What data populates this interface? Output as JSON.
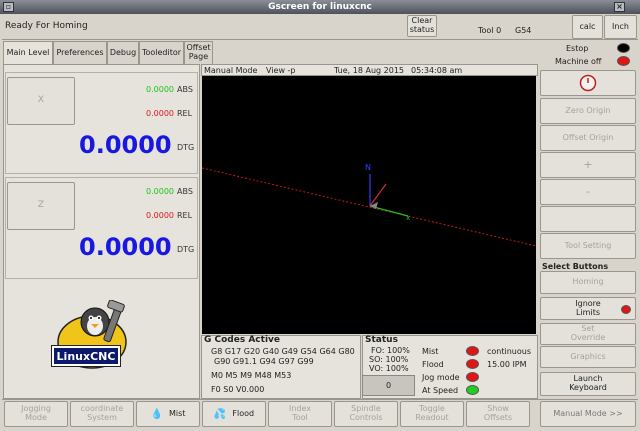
{
  "window": {
    "title": "Gscreen for linuxcnc"
  },
  "status_bar": {
    "message": "Ready For Homing",
    "clear_status": "Clear\nstatus",
    "tool": "Tool 0",
    "offset": "G54",
    "calc": "calc",
    "units": "Inch"
  },
  "tabs": [
    "Main Level",
    "Preferences",
    "Debug",
    "Tooleditor",
    "Offset\nPage"
  ],
  "axes": [
    {
      "button": "X",
      "abs": "0.0000",
      "abs_label": "ABS",
      "rel": "0.0000",
      "rel_label": "REL",
      "dtg": "0.0000",
      "dtg_label": "DTG"
    },
    {
      "button": "Z",
      "abs": "0.0000",
      "abs_label": "ABS",
      "rel": "0.0000",
      "rel_label": "REL",
      "dtg": "0.0000",
      "dtg_label": "DTG"
    }
  ],
  "graphics_header": {
    "mode": "Manual Mode",
    "view": "View -p",
    "date": "Tue, 18 Aug 2015",
    "time": "05:34:08 am"
  },
  "gcodes": {
    "title": "G Codes Active",
    "line1": "G8 G17 G20 G40 G49 G54 G64 G80",
    "line2": "G90 G91.1 G94 G97 G99",
    "line3": "M0 M5 M9 M48 M53",
    "line4": "F0   S0   V0.000"
  },
  "status": {
    "title": "Status",
    "fo": "FO: 100%",
    "so": "SO: 100%",
    "vo": "VO: 100%",
    "spindle": "0",
    "mist": "Mist",
    "flood": "Flood",
    "jog_mode": "Jog mode",
    "at_speed": "At Speed",
    "jog_type": "continuous",
    "jog_rate": "15.00 IPM"
  },
  "logo": {
    "text": "LinuxCNC"
  },
  "right_panel": {
    "estop": "Estop",
    "machine_off": "Machine off",
    "zero_origin": "Zero Origin",
    "offset_origin": "Offset Origin",
    "plus": "+",
    "minus": "-",
    "tool_setting": "Tool Setting",
    "select_buttons": "Select Buttons",
    "homing": "Homing",
    "ignore_limits": "Ignore\nLimits",
    "set_override": "Set\nOverride",
    "graphics": "Graphics",
    "launch_keyboard": "Launch\nKeyboard",
    "manual_mode": "Manual Mode >>"
  },
  "bottom_buttons": [
    "Jogging\nMode",
    "coordinate\nSystem",
    "Mist",
    "Flood",
    "Index\nTool",
    "Spindle\nControls",
    "Toggle\nReadout",
    "Show\nOffsets"
  ],
  "colors": {
    "abs": "#1bc41b",
    "rel": "#e01818",
    "dtg": "#1818e0",
    "lamp_red": "#e01515",
    "lamp_green": "#22cc22",
    "lamp_black": "#000000"
  }
}
